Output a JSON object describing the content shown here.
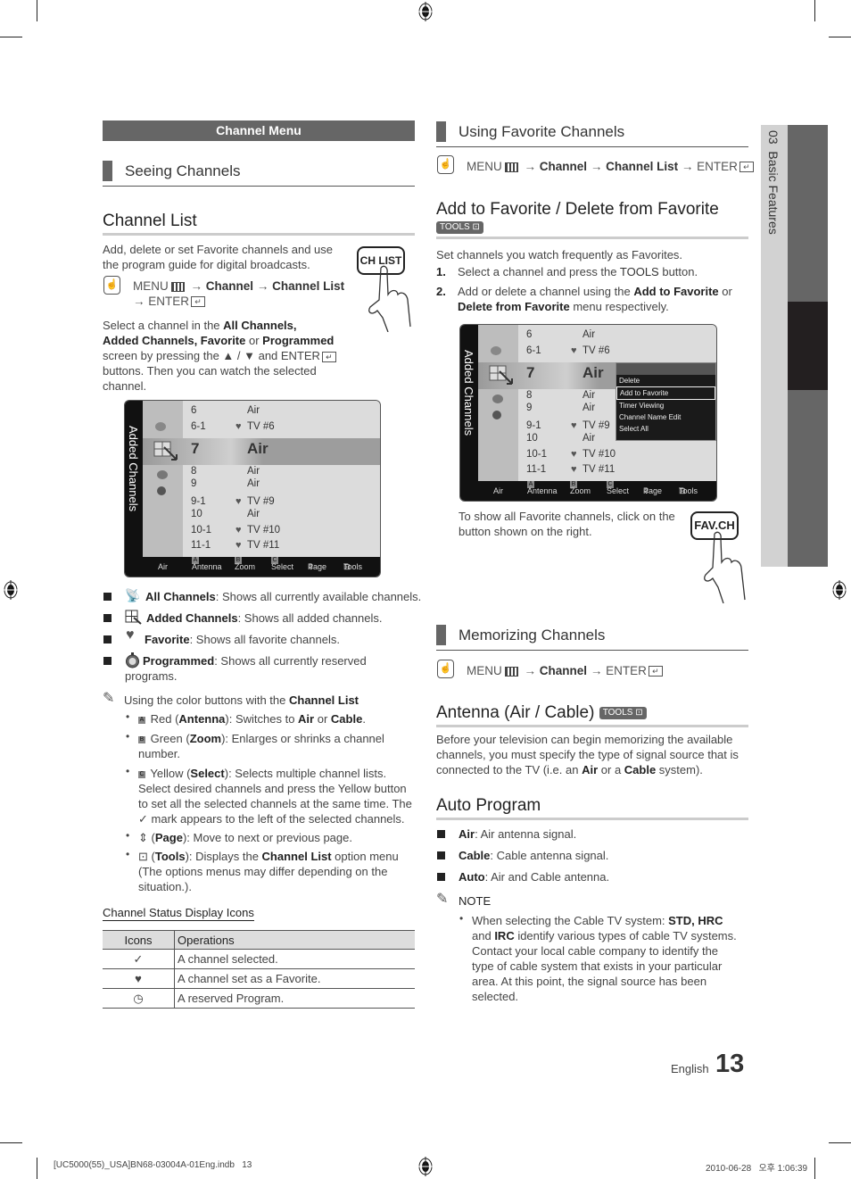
{
  "left": {
    "menu_bar": "Channel Menu",
    "seeing_channels": "Seeing Channels",
    "channel_list": {
      "title": "Channel List",
      "intro": [
        "Add, delete or set Favorite channels and use",
        "the program guide for digital broadcasts."
      ],
      "remote_button": "CH LIST",
      "path": {
        "menu": "MENU",
        "arrow": "→",
        "channel": "Channel",
        "channel_list": "Channel List",
        "enter": "ENTER"
      },
      "select_text": {
        "a": "Select a channel in the ",
        "b": "All Channels,",
        "c": "Added Channels, Favorite",
        "d": " or ",
        "e": "Programmed",
        "f": "screen by pressing the ▲ / ▼ and ENTER",
        "g": "buttons. Then you can watch the selected",
        "h": "channel."
      }
    },
    "screen": {
      "side_label": "Added Channels",
      "rows": [
        {
          "num": "6",
          "fav": "",
          "name": "Air"
        },
        {
          "num": "6-1",
          "fav": "♥",
          "name": "TV #6"
        },
        {
          "num": "7",
          "fav": "",
          "name": "Air"
        },
        {
          "num": "8",
          "fav": "",
          "name": "Air"
        },
        {
          "num": "9",
          "fav": "",
          "name": "Air"
        },
        {
          "num": "9-1",
          "fav": "♥",
          "name": "TV #9"
        },
        {
          "num": "10",
          "fav": "",
          "name": "Air"
        },
        {
          "num": "10-1",
          "fav": "♥",
          "name": "TV #10"
        },
        {
          "num": "11-1",
          "fav": "♥",
          "name": "TV #11"
        }
      ],
      "footer": {
        "source": "Air",
        "a_key": "A",
        "a": "Antenna",
        "b_key": "B",
        "b": "Zoom",
        "c_key": "C",
        "c": "Select",
        "page": "Page",
        "tools": "Tools"
      }
    },
    "modes": [
      {
        "label": "All Channels",
        "desc": ": Shows all currently available channels."
      },
      {
        "label": "Added Channels",
        "desc": ": Shows all added channels."
      },
      {
        "label": "Favorite",
        "desc": ": Shows all favorite channels."
      },
      {
        "label": "Programmed",
        "desc": ": Shows all currently reserved",
        "desc2": "programs."
      }
    ],
    "note": {
      "intro": "Using the color buttons with the ",
      "intro_b": "Channel List",
      "items": {
        "red_pre": " Red (",
        "red_b": "Antenna",
        "red_mid": "): Switches to ",
        "red_b2": "Air",
        "red_or": " or ",
        "red_b3": "Cable",
        "red_end": ".",
        "green_pre": " Green (",
        "green_b": "Zoom",
        "green_end": "): Enlarges or shrinks a channel",
        "green_2": "number.",
        "yellow_pre": " Yellow (",
        "yellow_b": "Select",
        "yellow_end": "): Selects multiple channel lists.",
        "yellow_2": "Select desired channels and press the Yellow button",
        "yellow_3": "to set all the selected channels at the same time. The",
        "yellow_4": "mark appears to the left of the selected channels.",
        "page_pre": " (",
        "page_b": "Page",
        "page_end": "): Move to next or previous page.",
        "tools_pre": " (",
        "tools_b": "Tools",
        "tools_mid": "): Displays the ",
        "tools_b2": "Channel List",
        "tools_end": " option menu",
        "tools_2": "(The options menus may differ depending on the",
        "tools_3": "situation.)."
      }
    },
    "status_icons": {
      "title": "Channel Status Display Icons",
      "headers": [
        "Icons",
        "Operations"
      ],
      "rows": [
        {
          "icon": "✓",
          "op": "A channel selected."
        },
        {
          "icon": "♥",
          "op": "A channel set as a Favorite."
        },
        {
          "icon": "◷",
          "op": "A reserved Program."
        }
      ]
    }
  },
  "right": {
    "using_favorites": "Using Favorite Channels",
    "path1": {
      "menu": "MENU",
      "arrow": "→",
      "channel": "Channel",
      "channel_list": "Channel List",
      "enter": "ENTER"
    },
    "add_fav": {
      "title": "Add to Favorite / Delete from Favorite",
      "tools_badge": "TOOLS",
      "intro": "Set channels you watch frequently as Favorites.",
      "step1_n": "1.",
      "step1_a": "Select a channel and press the ",
      "step1_b": "TOOLS",
      "step1_c": " button.",
      "step2_n": "2.",
      "step2_a": "Add or delete a channel using the ",
      "step2_b": "Add to Favorite",
      "step2_c": " or",
      "step2_d": "Delete from Favorite",
      "step2_e": " menu respectively."
    },
    "screen2": {
      "popup": [
        "Delete",
        "Add to Favorite",
        "Timer Viewing",
        "Channel Name Edit",
        "Select All"
      ],
      "popup_selected": "Add to Favorite"
    },
    "fav_text": [
      "To show all Favorite channels, click on the",
      "button shown on the right."
    ],
    "fav_button": "FAV.CH",
    "memorizing": "Memorizing Channels",
    "path2": {
      "menu": "MENU",
      "arrow": "→",
      "channel": "Channel",
      "enter": "ENTER"
    },
    "antenna": {
      "title": "Antenna (Air / Cable)",
      "tools_badge": "TOOLS",
      "p1": "Before your television can begin memorizing the available",
      "p2": "channels, you must specify the type of signal source that is",
      "p3a": "connected to the TV (i.e. an ",
      "p3b": "Air",
      "p3c": " or a ",
      "p3d": "Cable",
      "p3e": " system)."
    },
    "auto_program": {
      "title": "Auto Program",
      "items": [
        {
          "label": "Air",
          "desc": ": Air antenna signal."
        },
        {
          "label": "Cable",
          "desc": ": Cable antenna signal."
        },
        {
          "label": "Auto",
          "desc": ": Air and Cable antenna."
        }
      ],
      "note_label": "NOTE",
      "note": {
        "a": "When selecting the Cable TV system: ",
        "b": "STD, HRC",
        "c": "and ",
        "d": "IRC",
        "e": " identify various types of cable TV systems.",
        "f": "Contact your local cable company to identify the",
        "g": "type of cable system that exists in your particular",
        "h": "area. At this point, the signal source has been",
        "i": "selected."
      }
    }
  },
  "side_tab": {
    "chapter": "03",
    "label": "Basic Features"
  },
  "footer": {
    "language": "English",
    "page_number": "13",
    "file": "[UC5000(55)_USA]BN68-03004A-01Eng.indb   13",
    "timestamp": "2010-06-28   오후 1:06:39"
  }
}
